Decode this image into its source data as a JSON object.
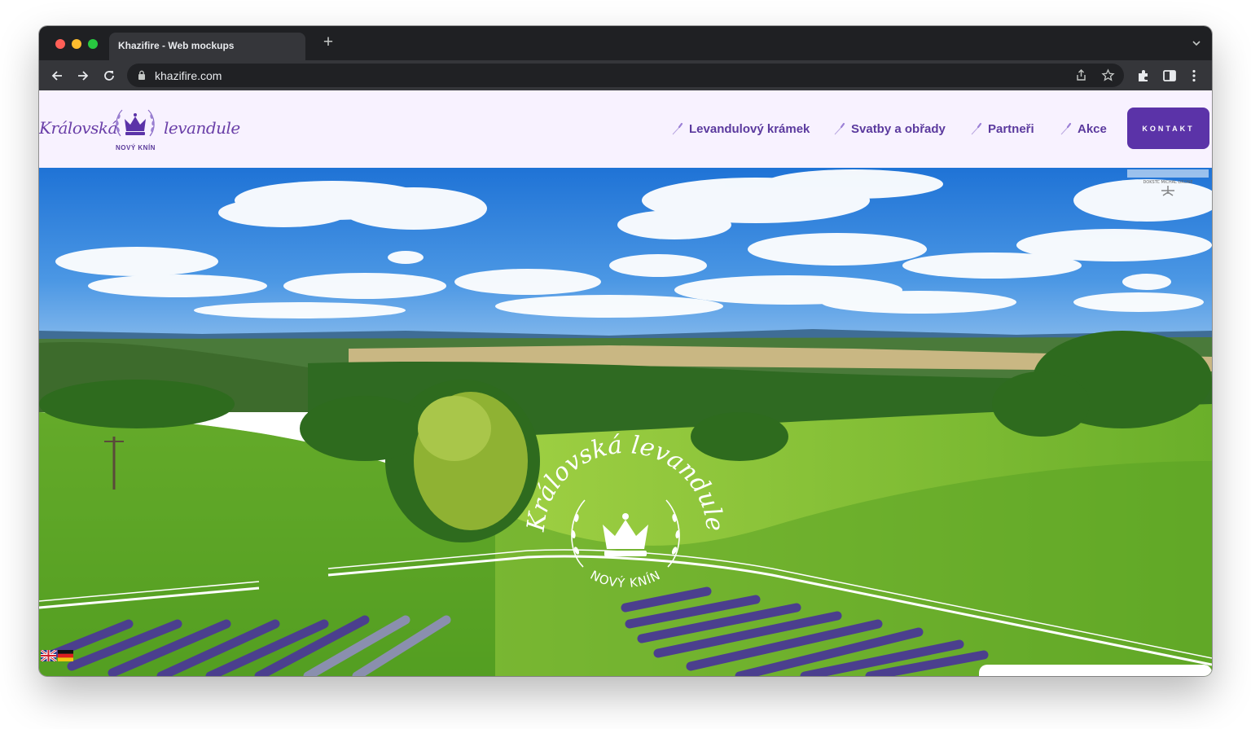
{
  "browser": {
    "tab_title": "Khazifire - Web mockups",
    "new_tab_label": "+",
    "url": "khazifire.com",
    "icons": [
      "back-arrow-icon",
      "forward-arrow-icon",
      "reload-icon",
      "lock-icon",
      "share-icon",
      "star-icon",
      "extensions-icon",
      "sidepanel-icon",
      "menu-dots-icon",
      "tab-list-chevron-icon"
    ]
  },
  "header": {
    "logo": {
      "word_left": "Královská",
      "word_right": "levandule",
      "subtitle": "NOVÝ KNÍN"
    },
    "nav": [
      {
        "label": "Levandulový krámek",
        "icon": "lavender-sprig-icon"
      },
      {
        "label": "Svatby a obřady",
        "icon": "lavender-sprig-icon"
      },
      {
        "label": "Partneři",
        "icon": "lavender-sprig-icon"
      },
      {
        "label": "Akce",
        "icon": "lavender-sprig-icon"
      }
    ],
    "contact_button": "KONTAKT"
  },
  "hero": {
    "emblem_title": "Královská levandule",
    "emblem_subtitle": "NOVÝ KNÍN",
    "watermark": "DOKSTC MICHAL DRONE",
    "language_flags": [
      "uk-flag-icon",
      "german-flag-icon"
    ]
  },
  "colors": {
    "brand_purple": "#5b33a8",
    "header_bg": "#f8f2ff",
    "nav_text": "#5b3a9e",
    "browser_dark": "#1f2023"
  }
}
